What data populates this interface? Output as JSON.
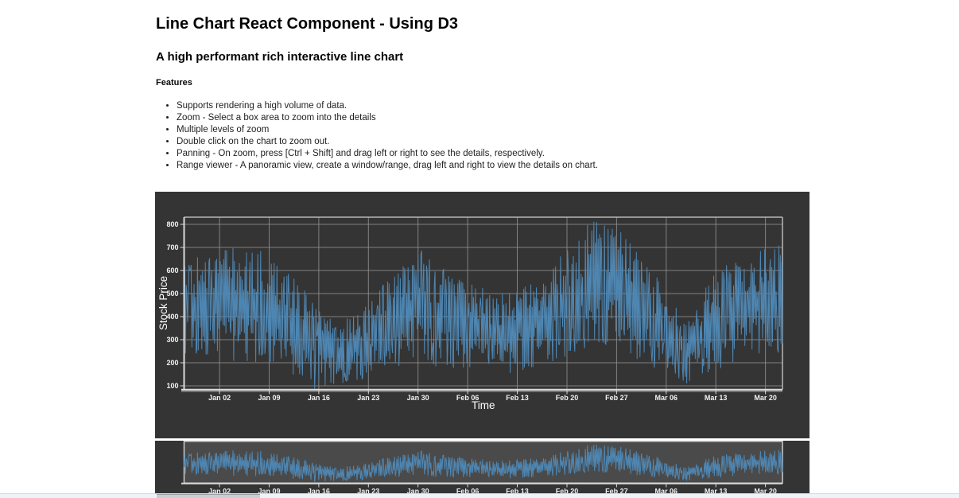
{
  "header": {
    "title": "Line Chart React Component - Using D3",
    "subtitle": "A high performant rich interactive line chart"
  },
  "features": {
    "heading": "Features",
    "items": [
      "Supports rendering a high volume of data.",
      "Zoom - Select a box area to zoom into the details",
      "Multiple levels of zoom",
      "Double click on the chart to zoom out.",
      "Panning - On zoom, press [Ctrl + Shift] and drag left or right to see the details, respectively.",
      "Range viewer - A panoramic view, create a window/range, drag left and right to view the details on chart."
    ]
  },
  "chart_data": {
    "type": "line",
    "title": "",
    "xlabel": "Time",
    "ylabel": "Stock Price",
    "x_tick_labels": [
      "Jan 02",
      "Jan 09",
      "Jan 16",
      "Jan 23",
      "Jan 30",
      "Feb 06",
      "Feb 13",
      "Feb 20",
      "Feb 27",
      "Mar 06",
      "Mar 13",
      "Mar 20"
    ],
    "y_tick_labels": [
      100,
      200,
      300,
      400,
      500,
      600,
      700,
      800
    ],
    "ylim": [
      85,
      845
    ],
    "grid": true,
    "legend": "none",
    "range_viewer": {
      "shares_x_ticks": true
    },
    "series": [
      {
        "name": "stock-price",
        "seed": 42,
        "days": 84.4,
        "points_per_day": 10,
        "first_tick_day": 5,
        "tick_step_days": 7,
        "clamp": [
          88,
          836
        ],
        "noise": {
          "flip_prob": 0.82,
          "mag_min": 0.15,
          "spike_prob": 0.02,
          "spike_gain": 1.18
        },
        "trend_anchors": [
          [
            0,
            430,
            190
          ],
          [
            5,
            450,
            240
          ],
          [
            9,
            455,
            250
          ],
          [
            12,
            430,
            240
          ],
          [
            16,
            350,
            210
          ],
          [
            19,
            265,
            165
          ],
          [
            22,
            235,
            135
          ],
          [
            26,
            300,
            165
          ],
          [
            30,
            390,
            215
          ],
          [
            33,
            445,
            255
          ],
          [
            37,
            400,
            225
          ],
          [
            40,
            350,
            195
          ],
          [
            44,
            330,
            180
          ],
          [
            47,
            355,
            200
          ],
          [
            51,
            400,
            215
          ],
          [
            54,
            455,
            235
          ],
          [
            58,
            545,
            285
          ],
          [
            61,
            520,
            270
          ],
          [
            65,
            420,
            220
          ],
          [
            68,
            345,
            195
          ],
          [
            71,
            255,
            150
          ],
          [
            75,
            380,
            215
          ],
          [
            79,
            450,
            235
          ],
          [
            84.4,
            480,
            235
          ]
        ]
      }
    ],
    "colors": {
      "line": "#4e86b2",
      "panel_bg": "#343434",
      "range_bg": "#4a4a4a",
      "grid": "#8f8f8f",
      "axis": "#d9d9d9",
      "plot_border": "#b8b8b8",
      "tick_text": "#f2f2f2",
      "axis_title": "#ffffff"
    }
  }
}
